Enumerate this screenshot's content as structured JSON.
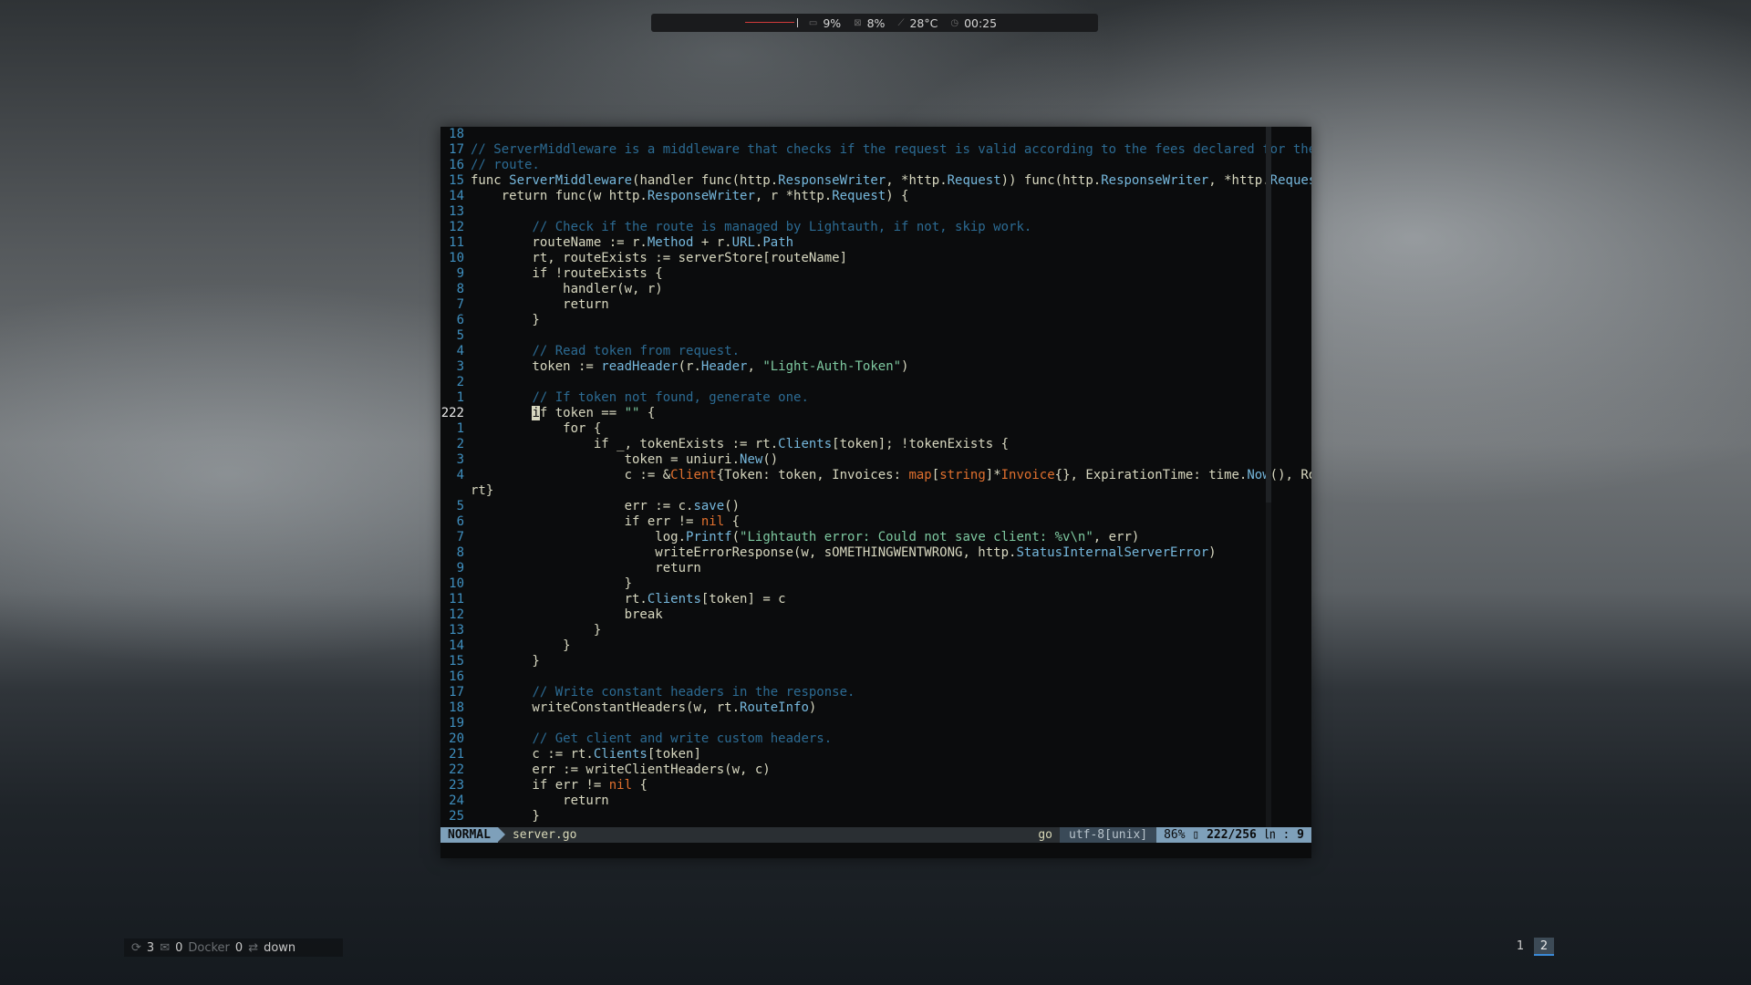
{
  "topbar": {
    "cpu": "9%",
    "mem": "8%",
    "temp": "28°C",
    "time": "00:25"
  },
  "statusline": {
    "mode": "NORMAL",
    "file": "server.go",
    "filetype": "go",
    "encoding": "utf-8[unix]",
    "percent": "86%",
    "position": "222/256",
    "column": "9"
  },
  "bottom": {
    "updates": "3",
    "mail": "0",
    "docker_label": "Docker",
    "docker_count": "0",
    "net": "down",
    "ws1": "1",
    "ws2": "2"
  },
  "code_lines": [
    {
      "n": "18",
      "t": ""
    },
    {
      "n": "17",
      "t": "// ServerMiddleware is a middleware that checks if the request is valid according to the fees declared for the"
    },
    {
      "n": "16",
      "t": "// route."
    },
    {
      "n": "15",
      "t": "func ServerMiddleware(handler func(http.ResponseWriter, *http.Request)) func(http.ResponseWriter, *http.Request) {"
    },
    {
      "n": "14",
      "t": "    return func(w http.ResponseWriter, r *http.Request) {"
    },
    {
      "n": "13",
      "t": ""
    },
    {
      "n": "12",
      "t": "        // Check if the route is managed by Lightauth, if not, skip work."
    },
    {
      "n": "11",
      "t": "        routeName := r.Method + r.URL.Path"
    },
    {
      "n": "10",
      "t": "        rt, routeExists := serverStore[routeName]"
    },
    {
      "n": "9",
      "t": "        if !routeExists {"
    },
    {
      "n": "8",
      "t": "            handler(w, r)"
    },
    {
      "n": "7",
      "t": "            return"
    },
    {
      "n": "6",
      "t": "        }"
    },
    {
      "n": "5",
      "t": ""
    },
    {
      "n": "4",
      "t": "        // Read token from request."
    },
    {
      "n": "3",
      "t": "        token := readHeader(r.Header, \"Light-Auth-Token\")"
    },
    {
      "n": "2",
      "t": ""
    },
    {
      "n": "1",
      "t": "        // If token not found, generate one."
    },
    {
      "n": "222",
      "t": "        if token == \"\" {"
    },
    {
      "n": "1",
      "t": "            for {"
    },
    {
      "n": "2",
      "t": "                if _, tokenExists := rt.Clients[token]; !tokenExists {"
    },
    {
      "n": "3",
      "t": "                    token = uniuri.New()"
    },
    {
      "n": "4",
      "t": "                    c := &Client{Token: token, Invoices: map[string]*Invoice{}, ExpirationTime: time.Now(), Route:"
    },
    {
      "n": "",
      "t": "rt}"
    },
    {
      "n": "5",
      "t": "                    err := c.save()"
    },
    {
      "n": "6",
      "t": "                    if err != nil {"
    },
    {
      "n": "7",
      "t": "                        log.Printf(\"Lightauth error: Could not save client: %v\\n\", err)"
    },
    {
      "n": "8",
      "t": "                        writeErrorResponse(w, sOMETHINGWENTWRONG, http.StatusInternalServerError)"
    },
    {
      "n": "9",
      "t": "                        return"
    },
    {
      "n": "10",
      "t": "                    }"
    },
    {
      "n": "11",
      "t": "                    rt.Clients[token] = c"
    },
    {
      "n": "12",
      "t": "                    break"
    },
    {
      "n": "13",
      "t": "                }"
    },
    {
      "n": "14",
      "t": "            }"
    },
    {
      "n": "15",
      "t": "        }"
    },
    {
      "n": "16",
      "t": ""
    },
    {
      "n": "17",
      "t": "        // Write constant headers in the response."
    },
    {
      "n": "18",
      "t": "        writeConstantHeaders(w, rt.RouteInfo)"
    },
    {
      "n": "19",
      "t": ""
    },
    {
      "n": "20",
      "t": "        // Get client and write custom headers."
    },
    {
      "n": "21",
      "t": "        c := rt.Clients[token]"
    },
    {
      "n": "22",
      "t": "        err := writeClientHeaders(w, c)"
    },
    {
      "n": "23",
      "t": "        if err != nil {"
    },
    {
      "n": "24",
      "t": "            return"
    },
    {
      "n": "25",
      "t": "        }"
    }
  ]
}
